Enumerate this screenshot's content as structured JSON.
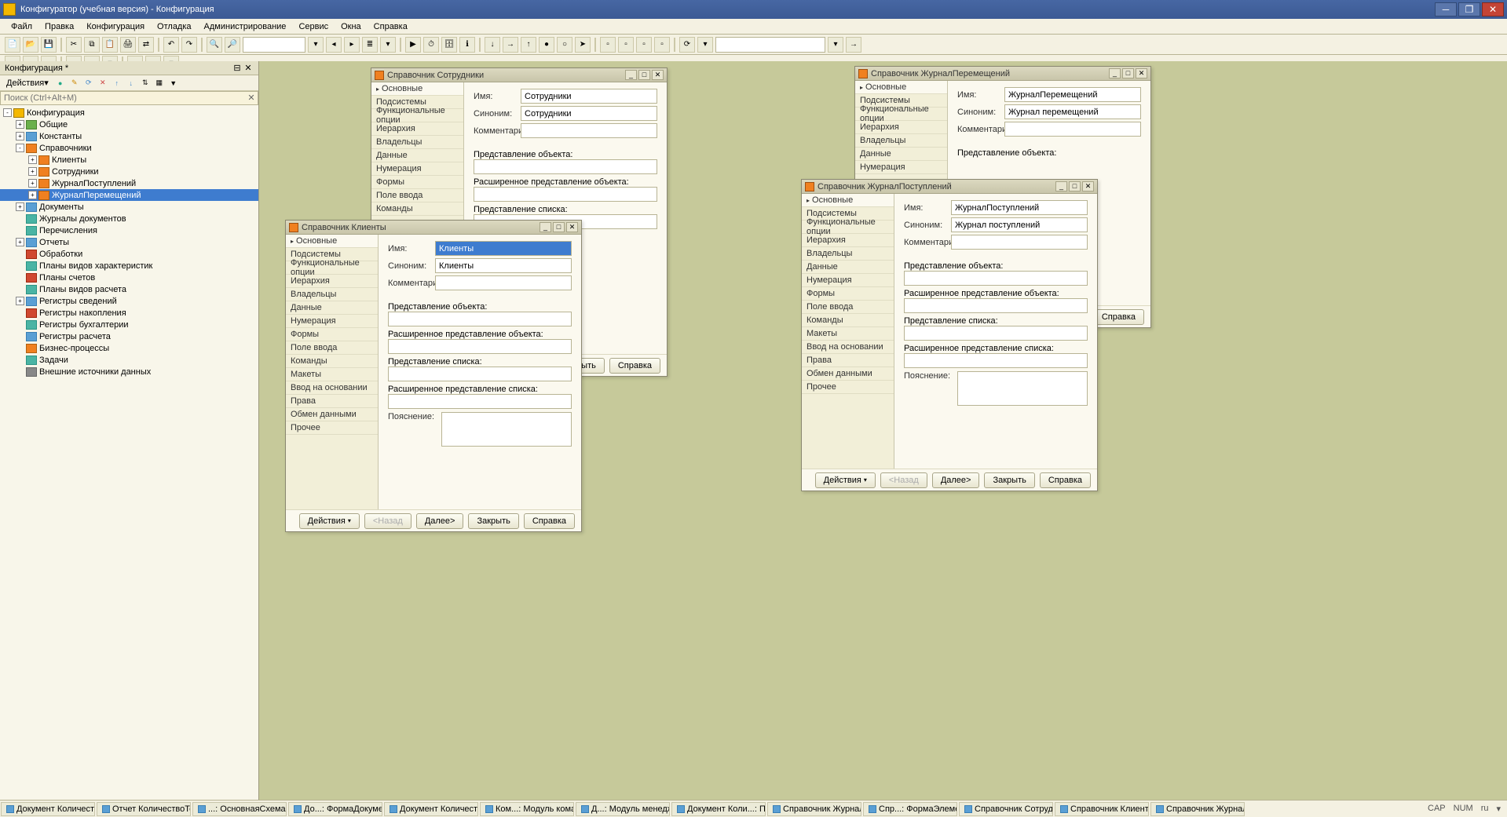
{
  "app": {
    "title": "Конфигуратор (учебная версия) - Конфигурация"
  },
  "menu": [
    "Файл",
    "Правка",
    "Конфигурация",
    "Отладка",
    "Администрирование",
    "Сервис",
    "Окна",
    "Справка"
  ],
  "config_panel": {
    "title": "Конфигурация *",
    "actions_label": "Действия",
    "search_placeholder": "Поиск (Ctrl+Alt+M)",
    "tree": [
      {
        "lvl": 0,
        "exp": "-",
        "icon": "ic-cube",
        "label": "Конфигурация"
      },
      {
        "lvl": 1,
        "exp": "+",
        "icon": "ic-folder",
        "label": "Общие"
      },
      {
        "lvl": 1,
        "exp": "+",
        "icon": "ic-blue",
        "label": "Константы"
      },
      {
        "lvl": 1,
        "exp": "-",
        "icon": "ic-orange",
        "label": "Справочники"
      },
      {
        "lvl": 2,
        "exp": "+",
        "icon": "ic-orange",
        "label": "Клиенты"
      },
      {
        "lvl": 2,
        "exp": "+",
        "icon": "ic-orange",
        "label": "Сотрудники"
      },
      {
        "lvl": 2,
        "exp": "+",
        "icon": "ic-orange",
        "label": "ЖурналПоступлений"
      },
      {
        "lvl": 2,
        "exp": "+",
        "icon": "ic-orange",
        "label": "ЖурналПеремещений",
        "sel": true
      },
      {
        "lvl": 1,
        "exp": "+",
        "icon": "ic-blue",
        "label": "Документы"
      },
      {
        "lvl": 1,
        "exp": "",
        "icon": "ic-teal",
        "label": "Журналы документов"
      },
      {
        "lvl": 1,
        "exp": "",
        "icon": "ic-teal",
        "label": "Перечисления"
      },
      {
        "lvl": 1,
        "exp": "+",
        "icon": "ic-blue",
        "label": "Отчеты"
      },
      {
        "lvl": 1,
        "exp": "",
        "icon": "ic-red",
        "label": "Обработки"
      },
      {
        "lvl": 1,
        "exp": "",
        "icon": "ic-teal",
        "label": "Планы видов характеристик"
      },
      {
        "lvl": 1,
        "exp": "",
        "icon": "ic-red",
        "label": "Планы счетов"
      },
      {
        "lvl": 1,
        "exp": "",
        "icon": "ic-teal",
        "label": "Планы видов расчета"
      },
      {
        "lvl": 1,
        "exp": "+",
        "icon": "ic-blue",
        "label": "Регистры сведений"
      },
      {
        "lvl": 1,
        "exp": "",
        "icon": "ic-red",
        "label": "Регистры накопления"
      },
      {
        "lvl": 1,
        "exp": "",
        "icon": "ic-teal",
        "label": "Регистры бухгалтерии"
      },
      {
        "lvl": 1,
        "exp": "",
        "icon": "ic-blue",
        "label": "Регистры расчета"
      },
      {
        "lvl": 1,
        "exp": "",
        "icon": "ic-orange",
        "label": "Бизнес-процессы"
      },
      {
        "lvl": 1,
        "exp": "",
        "icon": "ic-teal",
        "label": "Задачи"
      },
      {
        "lvl": 1,
        "exp": "",
        "icon": "ic-gray",
        "label": "Внешние источники данных"
      }
    ]
  },
  "tabs_full": [
    "Основные",
    "Подсистемы",
    "Функциональные опции",
    "Иерархия",
    "Владельцы",
    "Данные",
    "Нумерация",
    "Формы",
    "Поле ввода",
    "Команды",
    "Макеты",
    "Ввод на основании",
    "Права",
    "Обмен данными",
    "Прочее"
  ],
  "tabs_short": [
    "Основные",
    "Подсистемы",
    "Функциональные опции",
    "Иерархия",
    "Владельцы",
    "Данные",
    "Нумерация",
    "Формы",
    "Поле ввода",
    "Команды"
  ],
  "tabs_jper": [
    "Основные",
    "Подсистемы",
    "Функциональные опции",
    "Иерархия",
    "Владельцы",
    "Данные",
    "Нумерация"
  ],
  "form_labels": {
    "name": "Имя:",
    "synonym": "Синоним:",
    "comment": "Комментарий:",
    "obj_repr": "Представление объекта:",
    "ext_obj_repr": "Расширенное представление объекта:",
    "list_repr": "Представление списка:",
    "ext_list_repr": "Расширенное представление списка:",
    "explanation": "Пояснение:"
  },
  "buttons": {
    "actions": "Действия",
    "back": "<Назад",
    "next": "Далее>",
    "close": "Закрыть",
    "help": "Справка"
  },
  "windows": {
    "sotrudniki": {
      "title": "Справочник Сотрудники",
      "name": "Сотрудники",
      "synonym": "Сотрудники"
    },
    "klienty": {
      "title": "Справочник Клиенты",
      "name": "Клиенты",
      "synonym": "Клиенты"
    },
    "jpost": {
      "title": "Справочник ЖурналПоступлений",
      "name": "ЖурналПоступлений",
      "synonym": "Журнал поступлений"
    },
    "jper": {
      "title": "Справочник ЖурналПеремещений",
      "name": "ЖурналПеремещений",
      "synonym": "Журнал перемещений"
    }
  },
  "taskbar": [
    "Документ Количество...",
    "Отчет КоличествоТов...",
    "...: ОсновнаяСхемаКо...",
    "До...: ФормаДокумента",
    "Документ Количество...",
    "Ком...: Модуль команды",
    "Д...: Модуль менеджера",
    "Документ Коли...: Печать",
    "Справочник ЖурналП...",
    "Спр...: ФормаЭлемента",
    "Справочник Сотрудники",
    "Справочник Клиенты",
    "Справочник ЖурналП..."
  ],
  "status": {
    "cap": "CAP",
    "num": "NUM",
    "lang": "ru"
  }
}
